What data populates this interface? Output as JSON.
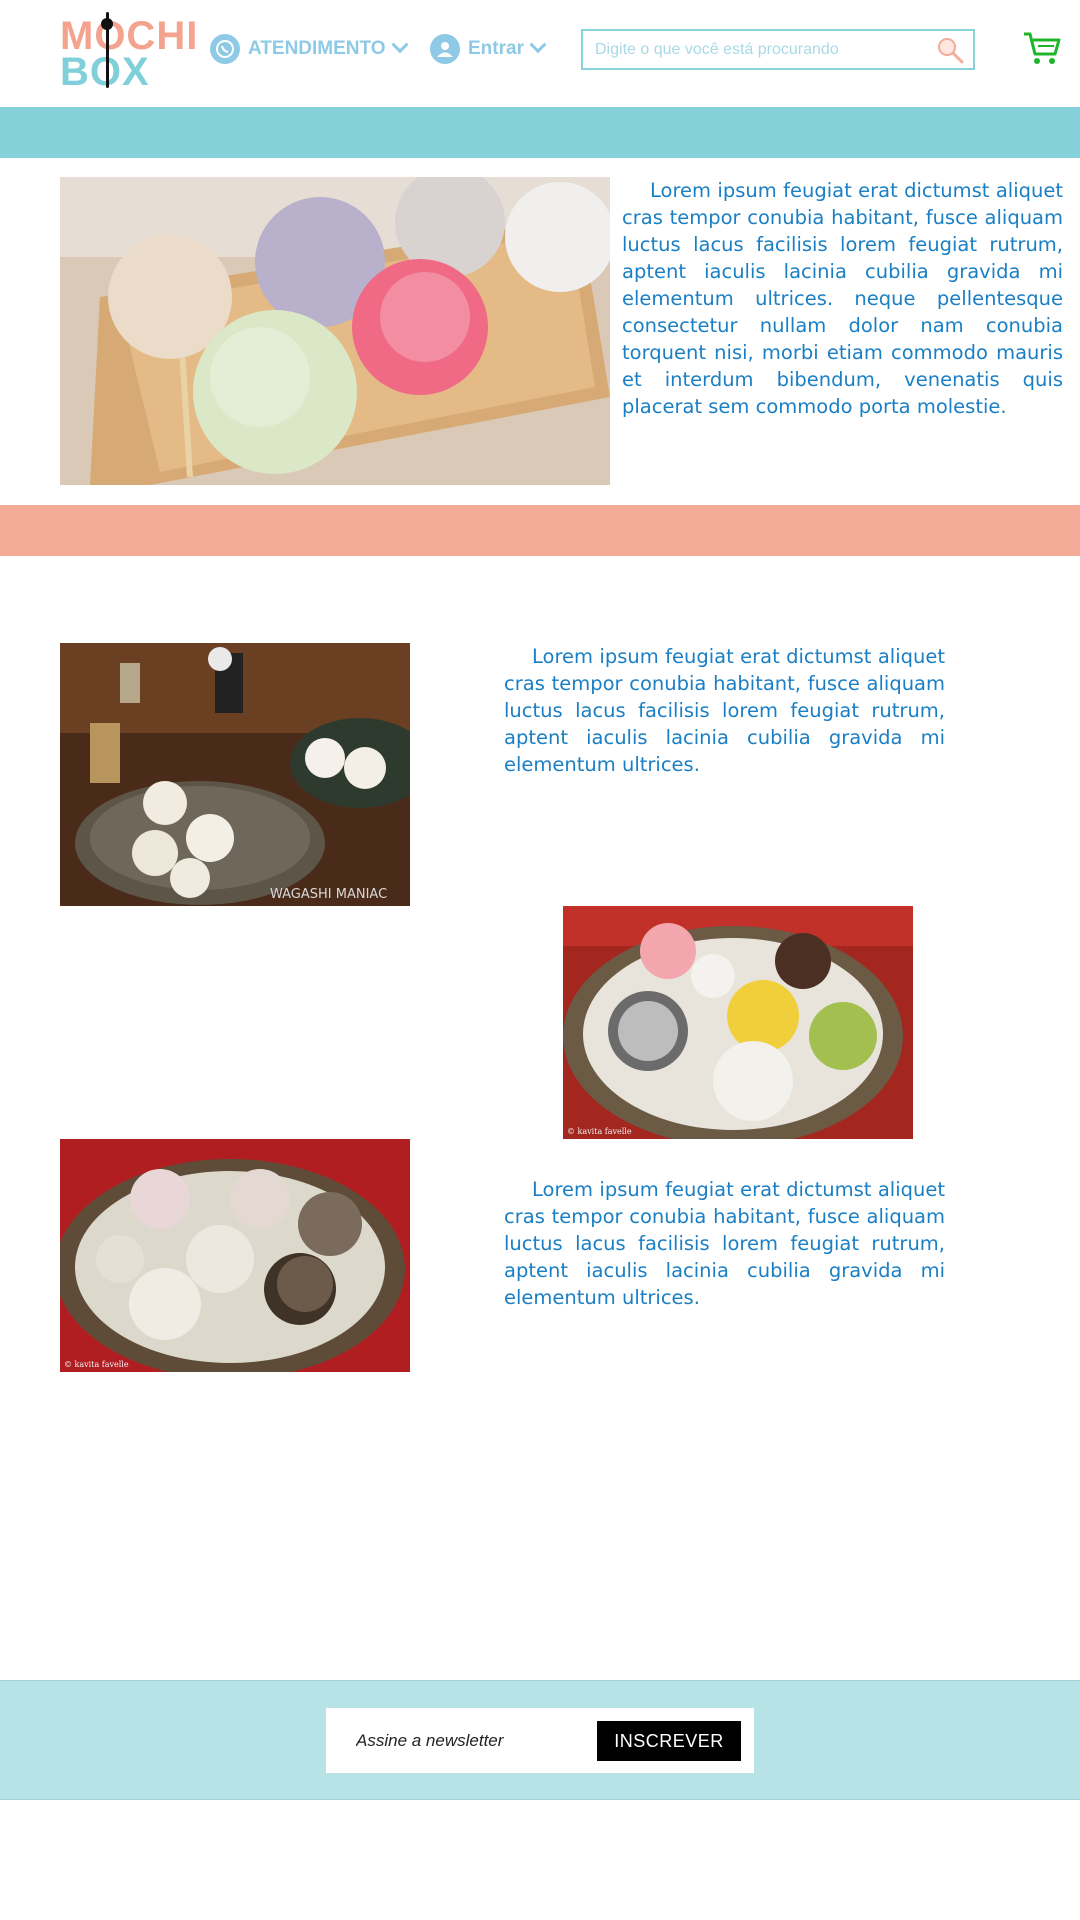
{
  "header": {
    "logo_line1": "MOCHI",
    "logo_line2": "BOX",
    "nav": {
      "atendimento": "ATENDIMENTO",
      "entrar": "Entrar"
    },
    "search": {
      "placeholder": "Digite o que você está procurando"
    }
  },
  "sections": {
    "intro_text": "Lorem ipsum feugiat erat dictumst aliquet cras tempor conubia habitant, fusce aliquam luctus lacus facilisis lorem feugiat rutrum, aptent iaculis lacinia cubilia gravida mi elementum ultrices. neque pellentesque consectetur nullam dolor nam conubia torquent nisi, morbi etiam commodo mauris et interdum bibendum, venenatis quis placerat sem commodo porta molestie.",
    "item1_text": "Lorem ipsum feugiat erat dictumst aliquet cras tempor conubia habitant, fusce aliquam luctus lacus facilisis lorem feugiat rutrum, aptent iaculis lacinia cubilia gravida mi elementum ultrices.",
    "item2_text": "Lorem ipsum feugiat erat dictumst aliquet cras tempor conubia habitant, fusce aliquam luctus lacus facilisis lorem feugiat rutrum, aptent iaculis lacinia cubilia gravida mi elementum ultrices.",
    "photo1_watermark": "WAGASHI MANIAC",
    "photo2_watermark": "© kavita favelle",
    "photo3_watermark": "© kavita favelle"
  },
  "newsletter": {
    "placeholder": "Assine a newsletter",
    "button": "INSCREVER"
  },
  "colors": {
    "teal": "#85d1d9",
    "salmon": "#f4ab97",
    "text_blue": "#1a7fc4",
    "cart_green": "#1db52a"
  }
}
